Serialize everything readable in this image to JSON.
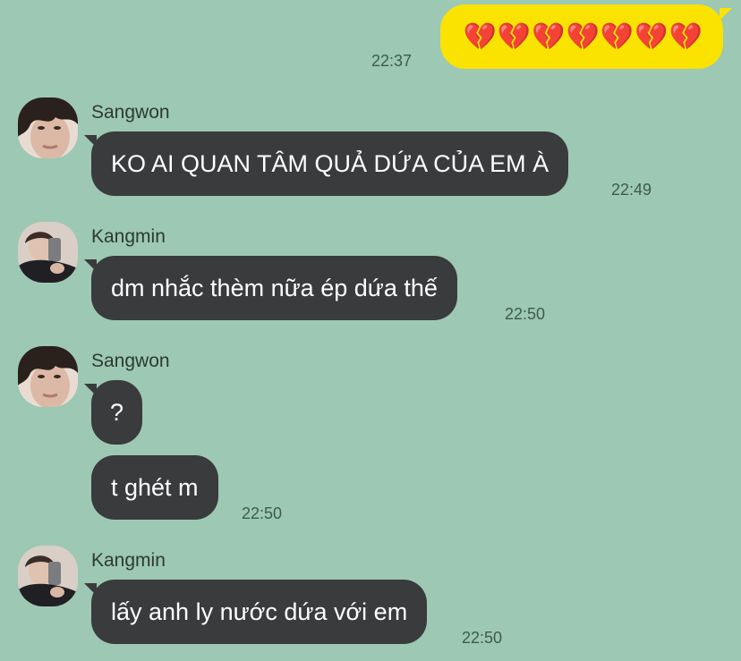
{
  "outgoing": {
    "text": "💔💔💔💔💔💔💔",
    "time": "22:37"
  },
  "messages": [
    {
      "sender": "Sangwon",
      "bubbles": [
        {
          "text": "KO AI QUAN TÂM QUẢ DỨA CỦA EM À",
          "time": "22:49"
        }
      ]
    },
    {
      "sender": "Kangmin",
      "bubbles": [
        {
          "text": "dm nhắc thèm nữa ép dứa thế",
          "time": "22:50"
        }
      ]
    },
    {
      "sender": "Sangwon",
      "bubbles": [
        {
          "text": "?",
          "time": ""
        },
        {
          "text": "t ghét m",
          "time": "22:50"
        }
      ]
    },
    {
      "sender": "Kangmin",
      "bubbles": [
        {
          "text": "lấy anh ly nước dứa với em",
          "time": "22:50"
        }
      ]
    }
  ]
}
